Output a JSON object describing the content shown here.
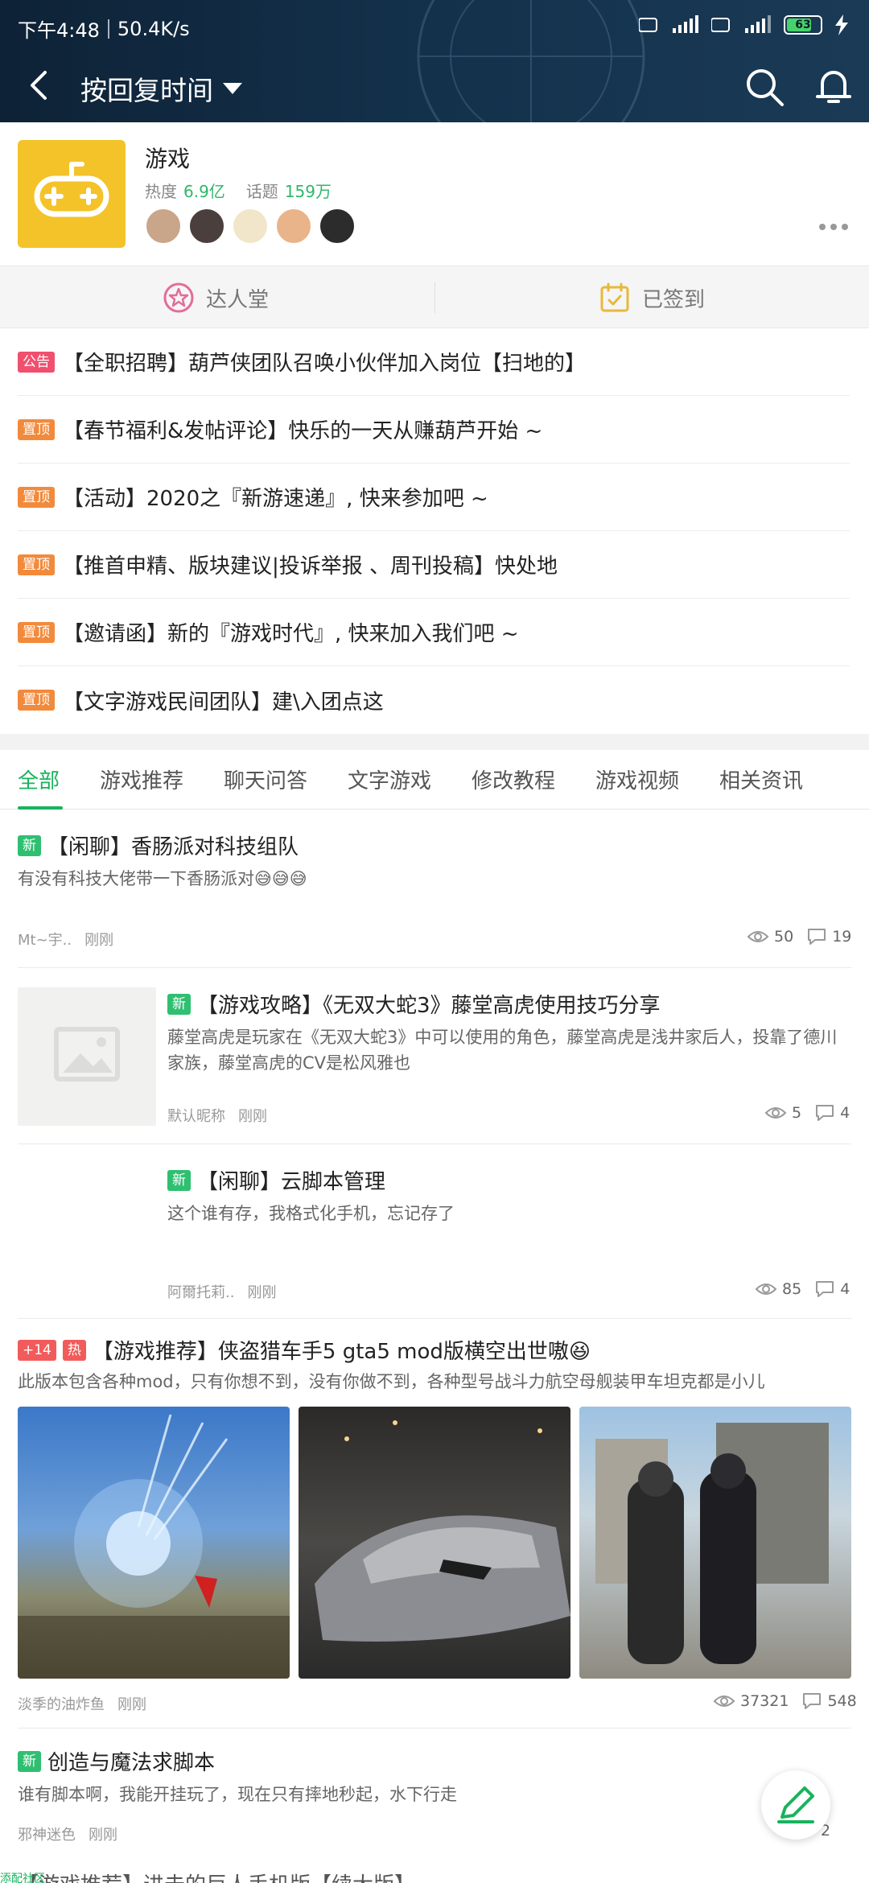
{
  "status_bar": {
    "time": "下午4:48",
    "speed": "50.4K/s",
    "battery": "63"
  },
  "header": {
    "title": "按回复时间"
  },
  "topic": {
    "name": "游戏",
    "heat_label": "热度",
    "heat_value": "6.9亿",
    "topics_label": "话题",
    "topics_value": "159万"
  },
  "quick_actions": {
    "experts": "达人堂",
    "checked_in": "已签到"
  },
  "pinned": [
    {
      "tag": "公告",
      "text": "【全职招聘】葫芦侠团队召唤小伙伴加入岗位【扫地的】"
    },
    {
      "tag": "置顶",
      "text": "【春节福利&发帖评论】快乐的一天从赚葫芦开始 ~"
    },
    {
      "tag": "置顶",
      "text": "【活动】2020之『新游速递』, 快来参加吧 ~"
    },
    {
      "tag": "置顶",
      "text": "【推首申精、版块建议|投诉举报 、周刊投稿】快处地"
    },
    {
      "tag": "置顶",
      "text": "【邀请函】新的『游戏时代』, 快来加入我们吧 ~"
    },
    {
      "tag": "置顶",
      "text": "【文字游戏民间团队】建\\入团点这"
    }
  ],
  "tabs": [
    "全部",
    "游戏推荐",
    "聊天问答",
    "文字游戏",
    "修改教程",
    "游戏视频",
    "相关资讯"
  ],
  "posts": [
    {
      "tag": "新",
      "title": "【闲聊】香肠派对科技组队",
      "desc": "有没有科技大佬带一下香肠派对😅😅😅",
      "author": "Mt~宇..",
      "time": "刚刚",
      "views": "50",
      "comments": "19"
    },
    {
      "tag": "新",
      "title": "【游戏攻略】《无双大蛇3》藤堂高虎使用技巧分享",
      "desc": "藤堂高虎是玩家在《无双大蛇3》中可以使用的角色，藤堂高虎是浅井家后人，投靠了德川家族，藤堂高虎的CV是松风雅也",
      "author": "默认昵称",
      "time": "刚刚",
      "views": "5",
      "comments": "4"
    },
    {
      "tag": "新",
      "title": "【闲聊】云脚本管理",
      "desc": "这个谁有存，我格式化手机，忘记存了",
      "author": "阿爾托莉..",
      "time": "刚刚",
      "views": "85",
      "comments": "4"
    },
    {
      "plus": "+14",
      "tag": "热",
      "title": "【游戏推荐】侠盗猎车手5  gta5 mod版横空出世嗷😆",
      "desc": "此版本包含各种mod，只有你想不到，没有你做不到，各种型号战斗力航空母舰装甲车坦克都是小儿",
      "author": "淡季的油炸鱼",
      "time": "刚刚",
      "views": "37321",
      "comments": "548"
    },
    {
      "tag": "新",
      "title": "创造与魔法求脚本",
      "desc": "谁有脚本啊，我能开挂玩了，现在只有摔地秒起，水下行走",
      "author": "邪神迷色",
      "time": "刚刚",
      "views": "",
      "comments": "2"
    }
  ],
  "next_partial": "【游戏推荐】进击的巨人手机版【续大版】",
  "watermark": "添配社区",
  "colors": {
    "accent": "#19b35d",
    "header_bg": "#13304a",
    "tag_red": "#f0506e",
    "tag_orange": "#f28a3c",
    "tag_green": "#2fbf71"
  }
}
